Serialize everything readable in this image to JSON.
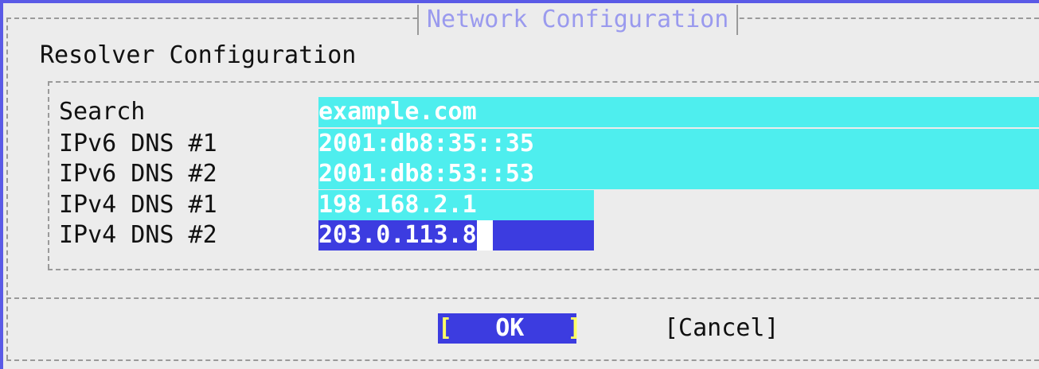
{
  "dialog": {
    "title": "Network Configuration",
    "subtitle": "Resolver Configuration"
  },
  "fields": [
    {
      "label": "Search",
      "value": "example.com"
    },
    {
      "label": "IPv6 DNS #1",
      "value": "2001:db8:35::35"
    },
    {
      "label": "IPv6 DNS #2",
      "value": "2001:db8:53::53"
    },
    {
      "label": "IPv4 DNS #1",
      "value": "198.168.2.1"
    },
    {
      "label": "IPv4 DNS #2",
      "value": "203.0.113.8"
    }
  ],
  "buttons": {
    "ok_left": "[",
    "ok_label": "OK",
    "ok_right": "]",
    "cancel_label": "[Cancel]"
  },
  "colors": {
    "background": "#5a5ae6",
    "dialog": "#ececec",
    "field": "#4eeeee",
    "active_field": "#3c3ce0",
    "title_text": "#9a9aee",
    "button_bracket": "#ffff66"
  }
}
